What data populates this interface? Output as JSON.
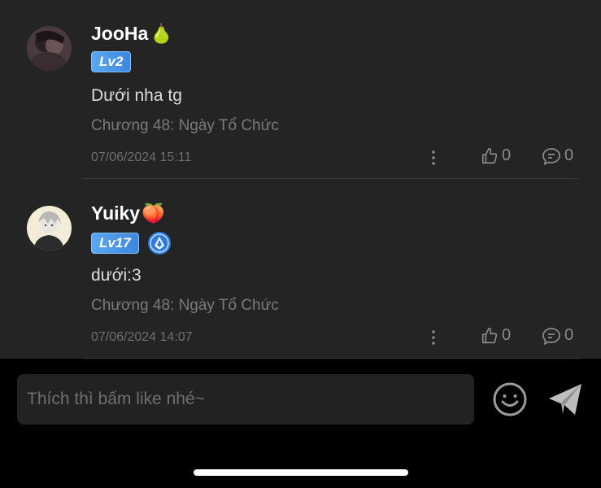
{
  "comments": [
    {
      "username": "JooHa",
      "username_emoji": "🍐",
      "level": "Lv2",
      "text": "Dưới nha tg",
      "chapter": "Chương 48: Ngày Tổ Chức",
      "timestamp": "07/06/2024 15:11",
      "likes": "0",
      "replies": "0",
      "has_special_badge": false
    },
    {
      "username": "Yuiky",
      "username_emoji": "🍑",
      "level": "Lv17",
      "text": "dưới:3",
      "chapter": "Chương 48: Ngày Tổ Chức",
      "timestamp": "07/06/2024 14:07",
      "likes": "0",
      "replies": "0",
      "has_special_badge": true
    }
  ],
  "composer": {
    "placeholder": "Thích thì bấm like nhé~"
  },
  "icons": {
    "more": "more-vertical-icon",
    "like": "thumbs-up-icon",
    "reply": "comment-icon",
    "emoji": "smiley-icon",
    "send": "send-icon",
    "badge": "blue-shield-badge-icon"
  },
  "colors": {
    "background": "#242424",
    "composer_background": "#000000",
    "level_badge": "#4a95e6",
    "text_primary": "#ffffff",
    "text_muted": "#7a7a7a"
  }
}
